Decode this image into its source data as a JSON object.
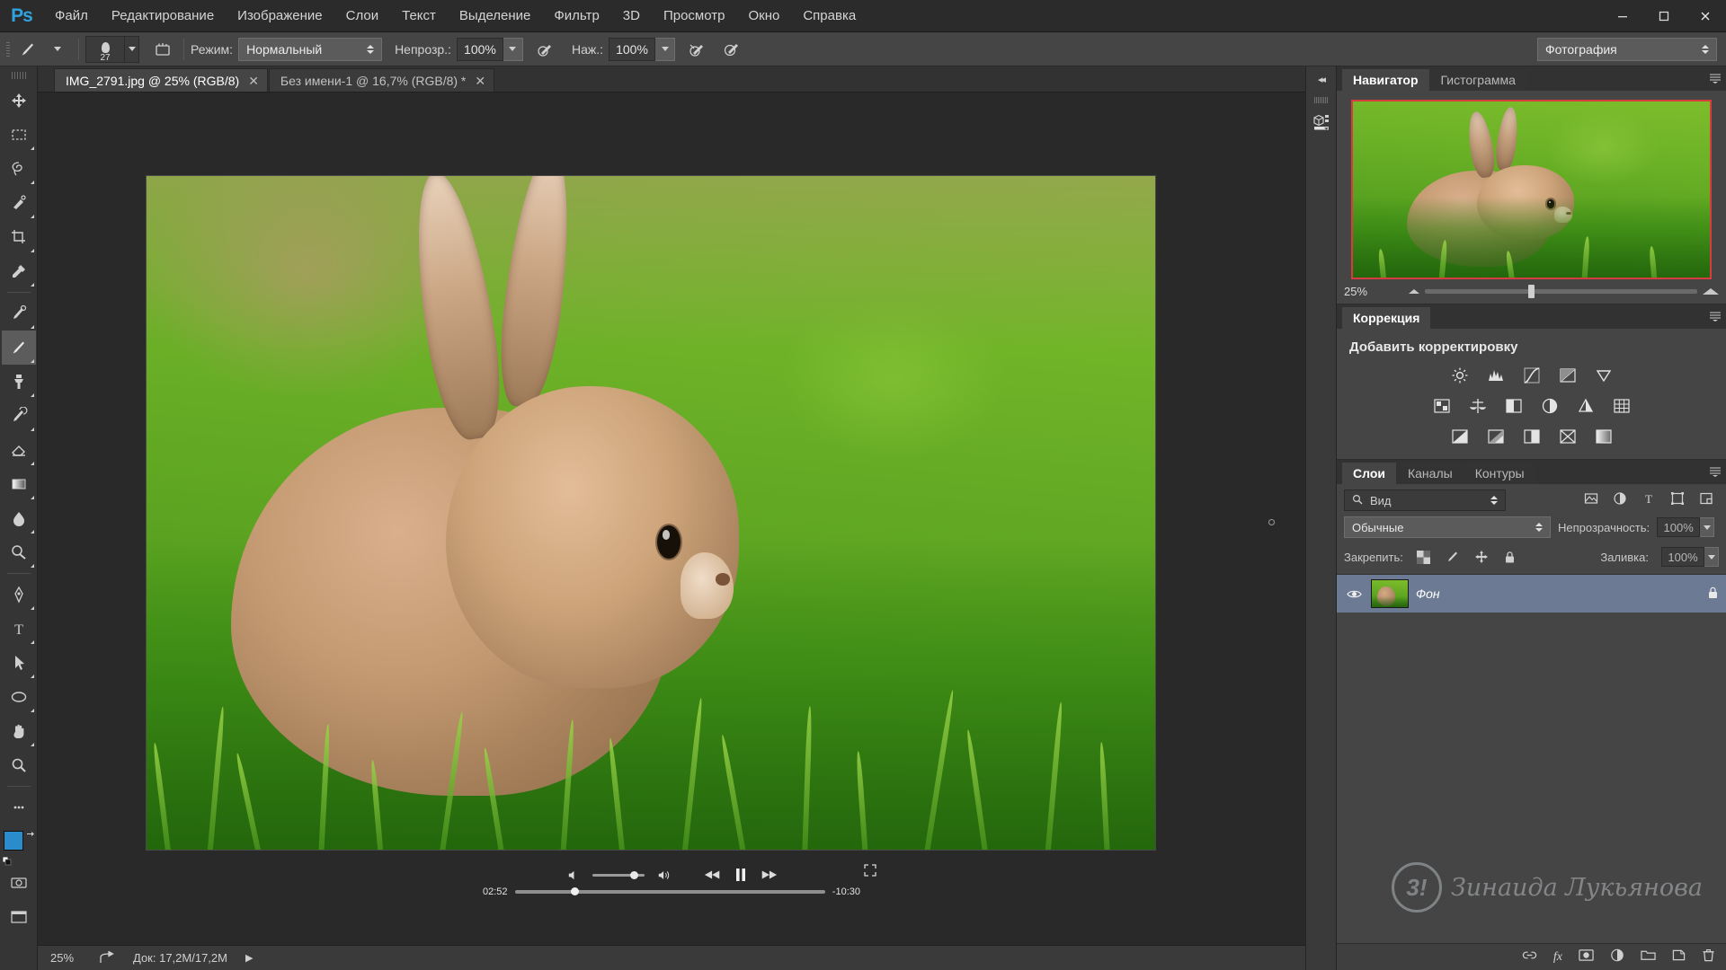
{
  "app": {
    "logo": "Ps",
    "menus": [
      "Файл",
      "Редактирование",
      "Изображение",
      "Слои",
      "Текст",
      "Выделение",
      "Фильтр",
      "3D",
      "Просмотр",
      "Окно",
      "Справка"
    ],
    "window_controls": {
      "minimize": "—",
      "maximize": "❐",
      "close": "✕"
    }
  },
  "options_bar": {
    "brush_size": "27",
    "mode_label": "Режим:",
    "mode_value": "Нормальный",
    "opacity_label": "Непрозр.:",
    "opacity_value": "100%",
    "flow_label": "Наж.:",
    "flow_value": "100%",
    "workspace": "Фотография",
    "icons": [
      "brush-preset-icon",
      "brush-panel-icon",
      "airbrush-icon",
      "pressure-opacity-icon",
      "pressure-size-icon"
    ]
  },
  "toolbar": {
    "tools": [
      {
        "name": "move-tool",
        "glyph": "✛",
        "has_flyout": false
      },
      {
        "name": "marquee-tool",
        "glyph": "⬚",
        "has_flyout": true
      },
      {
        "name": "lasso-tool",
        "glyph": "⦸",
        "has_flyout": true
      },
      {
        "name": "quick-selection-tool",
        "glyph": "✒",
        "has_flyout": true
      },
      {
        "name": "crop-tool",
        "glyph": "⌗",
        "has_flyout": true
      },
      {
        "name": "eyedropper-tool",
        "glyph": "✒",
        "has_flyout": true
      },
      {
        "name": "spot-healing-brush-tool",
        "glyph": "❂",
        "has_flyout": true
      },
      {
        "name": "brush-tool",
        "glyph": "✐",
        "has_flyout": true,
        "active": true
      },
      {
        "name": "clone-stamp-tool",
        "glyph": "⚑",
        "has_flyout": true
      },
      {
        "name": "history-brush-tool",
        "glyph": "➰",
        "has_flyout": true
      },
      {
        "name": "eraser-tool",
        "glyph": "◰",
        "has_flyout": true
      },
      {
        "name": "gradient-tool",
        "glyph": "▤",
        "has_flyout": true
      },
      {
        "name": "blur-tool",
        "glyph": "◖",
        "has_flyout": true
      },
      {
        "name": "dodge-tool",
        "glyph": "●",
        "has_flyout": true
      },
      {
        "name": "pen-tool",
        "glyph": "✑",
        "has_flyout": true
      },
      {
        "name": "type-tool",
        "glyph": "T",
        "has_flyout": true
      },
      {
        "name": "path-selection-tool",
        "glyph": "➤",
        "has_flyout": true
      },
      {
        "name": "shape-tool",
        "glyph": "⬭",
        "has_flyout": true
      },
      {
        "name": "hand-tool",
        "glyph": "✋",
        "has_flyout": true
      },
      {
        "name": "zoom-tool",
        "glyph": "⌕",
        "has_flyout": false
      }
    ],
    "foreground_color": "#2a8ccc",
    "background_color": "#ffffff",
    "quick_mask_icon": "◎",
    "screen_mode_icon": "❑"
  },
  "documents": {
    "tabs": [
      {
        "label": "IMG_2791.jpg @ 25% (RGB/8)",
        "close": "✕",
        "active": true
      },
      {
        "label": "Без имени-1 @ 16,7% (RGB/8) *",
        "close": "✕",
        "active": false
      }
    ]
  },
  "video_controls": {
    "volume_low_icon": "🔈",
    "volume_high_icon": "🔊",
    "rewind_icon": "◀◀",
    "pause_icon": "❚❚",
    "forward_icon": "▶▶",
    "expand_icon": "⤡",
    "current_time": "02:52",
    "remaining_time": "-10:30"
  },
  "status_bar": {
    "zoom": "25%",
    "share_icon": "share-icon",
    "doc_info": "Док: 17,2M/17,2M",
    "expand_arrow": "▶"
  },
  "dock_strip": {
    "collapse_icon": "◂◂",
    "icons": [
      "3d-panel-icon"
    ]
  },
  "navigator": {
    "tabs": [
      {
        "label": "Навигатор",
        "active": true
      },
      {
        "label": "Гистограмма",
        "active": false
      }
    ],
    "zoom_value": "25%",
    "menu_icon": "≡",
    "view_box_color": "#d93c3c"
  },
  "adjustments": {
    "tabs": [
      {
        "label": "Коррекция",
        "active": true
      }
    ],
    "title": "Добавить корректировку",
    "menu_icon": "≡",
    "rows": [
      [
        {
          "name": "brightness-contrast-icon",
          "glyph": "☀"
        },
        {
          "name": "levels-icon",
          "glyph": "▄"
        },
        {
          "name": "curves-icon",
          "glyph": "↗"
        },
        {
          "name": "exposure-icon",
          "glyph": "◧"
        },
        {
          "name": "vibrance-icon",
          "glyph": "▽"
        }
      ],
      [
        {
          "name": "hue-saturation-icon",
          "glyph": "▣"
        },
        {
          "name": "color-balance-icon",
          "glyph": "⚖"
        },
        {
          "name": "black-white-icon",
          "glyph": "◐"
        },
        {
          "name": "photo-filter-icon",
          "glyph": "◕"
        },
        {
          "name": "channel-mixer-icon",
          "glyph": "▲"
        },
        {
          "name": "color-lookup-icon",
          "glyph": "⊞"
        }
      ],
      [
        {
          "name": "invert-icon",
          "glyph": "◨"
        },
        {
          "name": "posterize-icon",
          "glyph": "◩"
        },
        {
          "name": "threshold-icon",
          "glyph": "◪"
        },
        {
          "name": "selective-color-icon",
          "glyph": "⌧"
        },
        {
          "name": "gradient-map-icon",
          "glyph": "▧"
        }
      ]
    ]
  },
  "layers": {
    "tabs": [
      {
        "label": "Слои",
        "active": true
      },
      {
        "label": "Каналы",
        "active": false
      },
      {
        "label": "Контуры",
        "active": false
      }
    ],
    "menu_icon": "≡",
    "filter_label": "Вид",
    "filter_icon": "search-icon",
    "filter_type_icons": [
      "pixel-filter-icon",
      "adjustment-filter-icon",
      "type-filter-icon",
      "shape-filter-icon",
      "smart-object-filter-icon"
    ],
    "blend_mode": "Обычные",
    "opacity_label": "Непрозрачность:",
    "opacity_value": "100%",
    "lock_label": "Закрепить:",
    "lock_icons": [
      "lock-transparent-icon",
      "lock-image-icon",
      "lock-position-icon",
      "lock-all-icon"
    ],
    "fill_label": "Заливка:",
    "fill_value": "100%",
    "items": [
      {
        "name": "Фон",
        "visible": true,
        "locked": true,
        "lock_glyph": "🔒",
        "eye_glyph": "👁"
      }
    ],
    "footer_icons": [
      {
        "name": "link-layers-icon",
        "glyph": "🔗"
      },
      {
        "name": "layer-style-icon",
        "glyph": "fx"
      },
      {
        "name": "layer-mask-icon",
        "glyph": "▣"
      },
      {
        "name": "new-fill-adjustment-icon",
        "glyph": "◑"
      },
      {
        "name": "new-group-icon",
        "glyph": "📁"
      },
      {
        "name": "new-layer-icon",
        "glyph": "❐"
      },
      {
        "name": "delete-layer-icon",
        "glyph": "🗑"
      }
    ]
  },
  "watermark": {
    "logo": "3!",
    "text": "Зинаида Лукьянова"
  }
}
